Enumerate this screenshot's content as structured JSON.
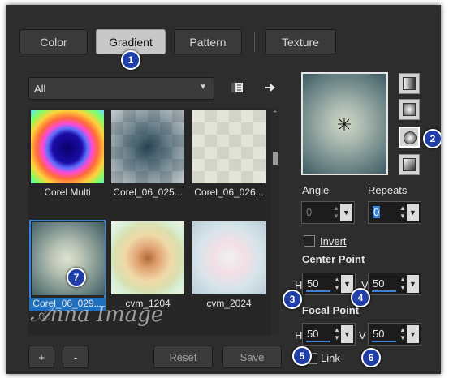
{
  "tabs": [
    {
      "label": "Color"
    },
    {
      "label": "Gradient"
    },
    {
      "label": "Pattern"
    },
    {
      "label": "Texture"
    }
  ],
  "category_select": {
    "value": "All"
  },
  "thumbnails": [
    {
      "caption": "Corel Multi"
    },
    {
      "caption": "Corel_06_025..."
    },
    {
      "caption": "Corel_06_026..."
    },
    {
      "caption": "Corel_06_029..."
    },
    {
      "caption": "cvm_1204"
    },
    {
      "caption": "cvm_2024"
    }
  ],
  "angle": {
    "label": "Angle",
    "value": "0"
  },
  "repeats": {
    "label": "Repeats",
    "value": "0"
  },
  "invert": {
    "label": "Invert",
    "checked": false
  },
  "center_point": {
    "label": "Center Point",
    "h_label": "H",
    "h_value": "50",
    "v_label": "V",
    "v_value": "50"
  },
  "focal_point": {
    "label": "Focal Point",
    "h_label": "H",
    "h_value": "50",
    "v_label": "V",
    "v_value": "50"
  },
  "link": {
    "label": "Link",
    "checked": false
  },
  "buttons": {
    "add": "+",
    "remove": "-",
    "reset": "Reset",
    "save": "Save"
  },
  "badges": [
    "1",
    "2",
    "3",
    "4",
    "5",
    "6",
    "7"
  ],
  "watermark": "Anna Image",
  "colors": {
    "accent": "#3b82d6",
    "panel": "#2d2d2d",
    "badge": "#1f3ea8"
  }
}
